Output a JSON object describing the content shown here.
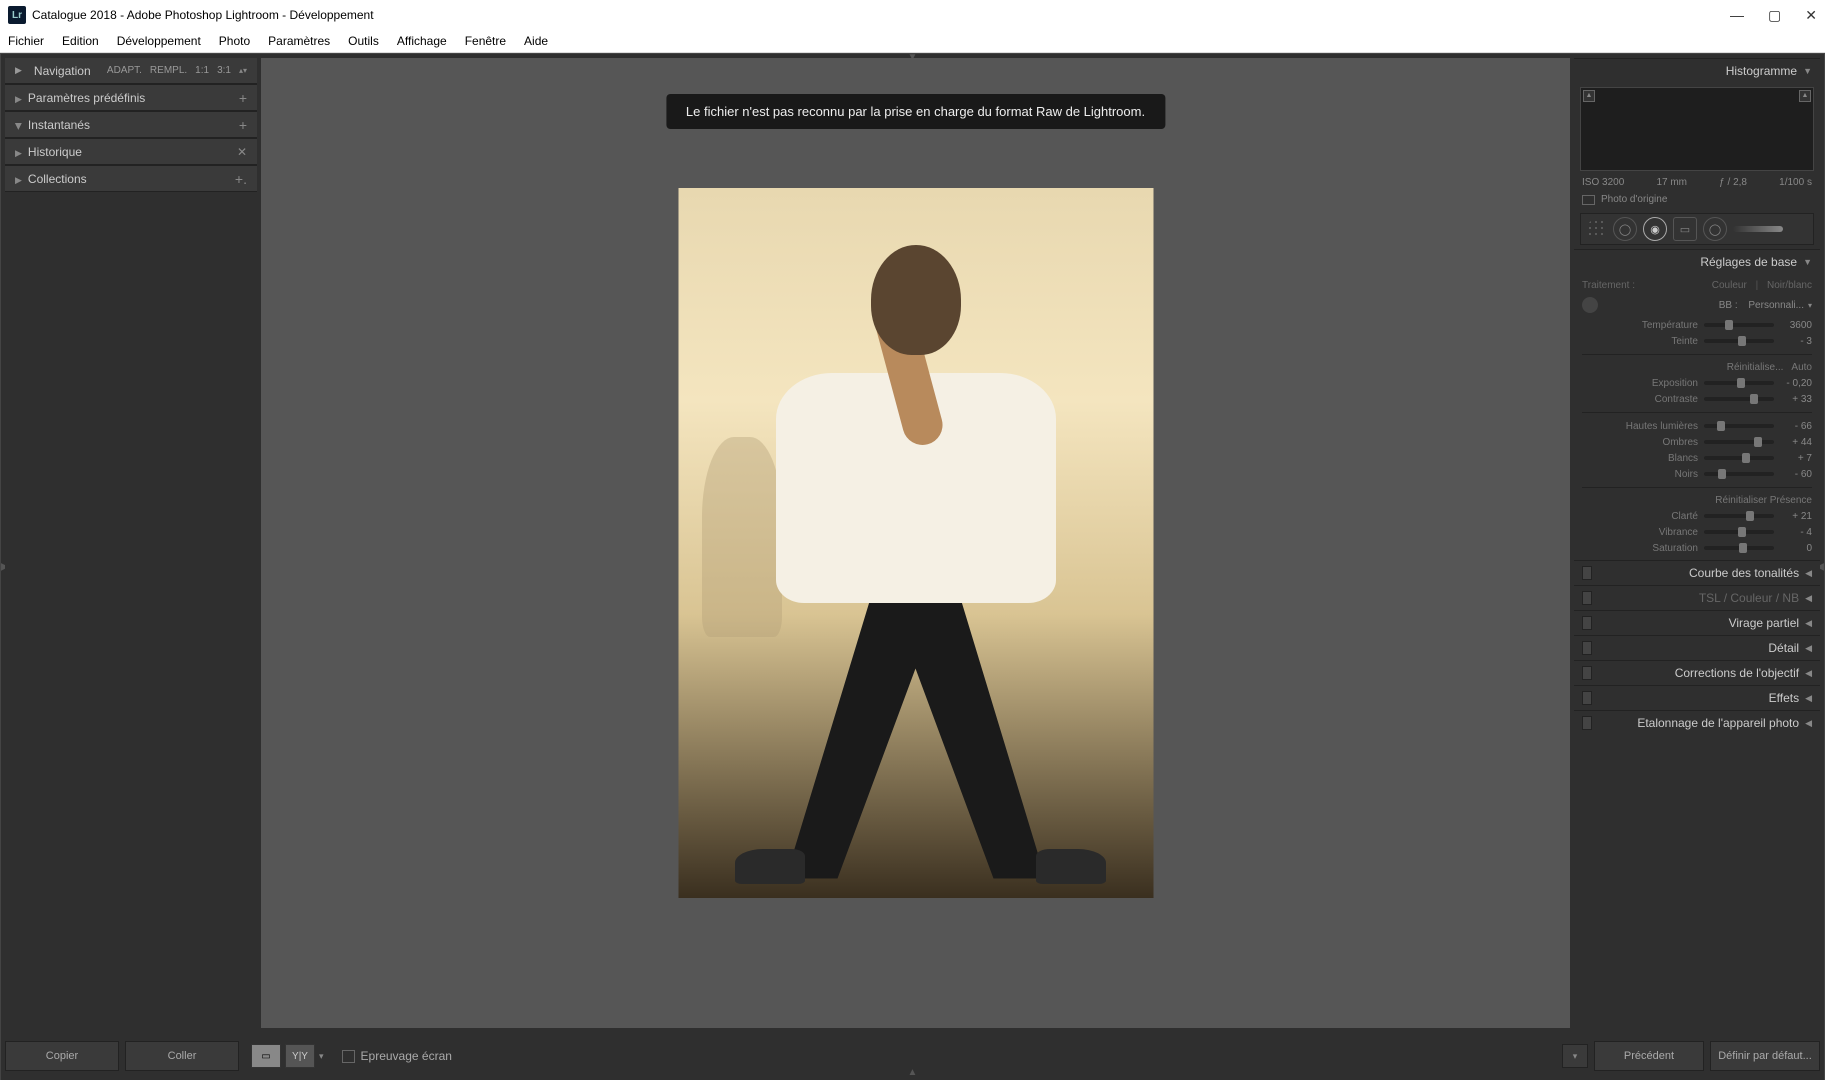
{
  "title": "Catalogue 2018 - Adobe Photoshop Lightroom - Développement",
  "menu": [
    "Fichier",
    "Edition",
    "Développement",
    "Photo",
    "Paramètres",
    "Outils",
    "Affichage",
    "Fenêtre",
    "Aide"
  ],
  "left": {
    "nav": {
      "label": "Navigation",
      "modes": [
        "ADAPT.",
        "REMPL.",
        "1:1",
        "3:1"
      ]
    },
    "panels": [
      {
        "label": "Paramètres prédéfinis",
        "icon": "plus"
      },
      {
        "label": "Instantanés",
        "icon": "plus"
      },
      {
        "label": "Historique",
        "icon": "x"
      },
      {
        "label": "Collections",
        "icon": "plus"
      }
    ]
  },
  "footer": {
    "copy": "Copier",
    "paste": "Coller",
    "softproof": "Epreuvage écran",
    "prev": "Précédent",
    "reset": "Définir par défaut..."
  },
  "toast": "Le fichier n'est pas reconnu par la prise en charge du format Raw de Lightroom.",
  "right": {
    "histogram": "Histogramme",
    "exif": {
      "iso": "ISO 3200",
      "focal": "17 mm",
      "aperture": "ƒ / 2,8",
      "shutter": "1/100 s"
    },
    "origin": "Photo d'origine",
    "basic": {
      "title": "Réglages de base",
      "treatment": {
        "label": "Traitement :",
        "color": "Couleur",
        "bw": "Noir/blanc"
      },
      "wb": {
        "label": "BB :",
        "value": "Personnali..."
      },
      "temp": {
        "label": "Température",
        "value": "3600",
        "pos": 30
      },
      "tint": {
        "label": "Teinte",
        "value": "- 3",
        "pos": 48
      },
      "tone_reset": "Réinitialise...",
      "tone_auto": "Auto",
      "exposure": {
        "label": "Exposition",
        "value": "- 0,20",
        "pos": 47
      },
      "contrast": {
        "label": "Contraste",
        "value": "+ 33",
        "pos": 65
      },
      "highlights": {
        "label": "Hautes lumières",
        "value": "- 66",
        "pos": 18
      },
      "shadows": {
        "label": "Ombres",
        "value": "+ 44",
        "pos": 72
      },
      "whites": {
        "label": "Blancs",
        "value": "+ 7",
        "pos": 54
      },
      "blacks": {
        "label": "Noirs",
        "value": "- 60",
        "pos": 20
      },
      "presence_reset": "Réinitialiser Présence",
      "clarity": {
        "label": "Clarté",
        "value": "+ 21",
        "pos": 60
      },
      "vibrance": {
        "label": "Vibrance",
        "value": "- 4",
        "pos": 48
      },
      "saturation": {
        "label": "Saturation",
        "value": "0",
        "pos": 50
      }
    },
    "sections": [
      "Courbe des tonalités",
      "TSL   /   Couleur   /   NB",
      "Virage partiel",
      "Détail",
      "Corrections de l'objectif",
      "Effets",
      "Etalonnage de l'appareil photo"
    ]
  }
}
